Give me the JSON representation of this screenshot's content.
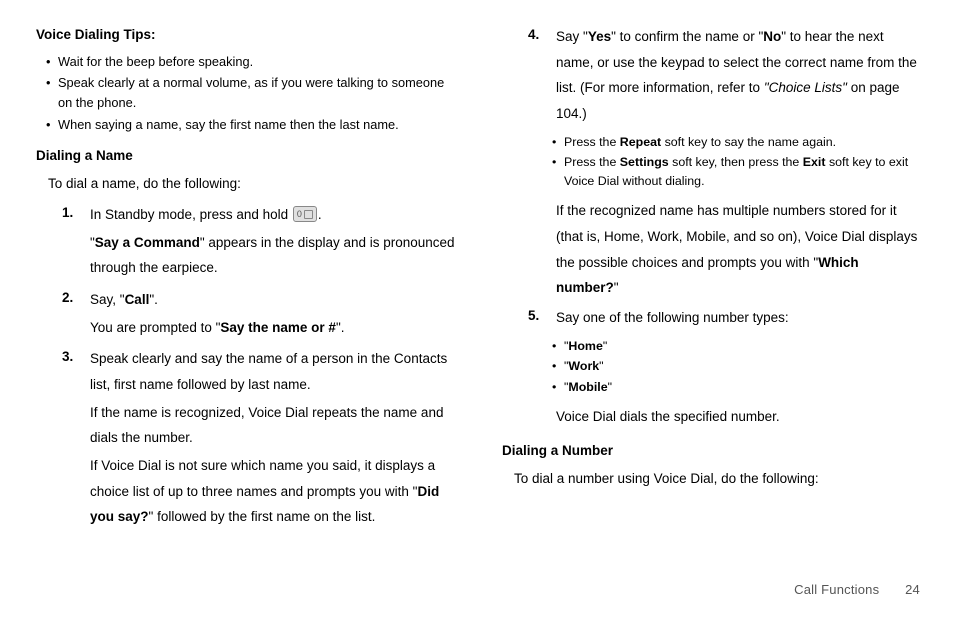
{
  "left": {
    "tipsHeader": "Voice Dialing Tips:",
    "tips": {
      "t1": "Wait for the beep before speaking.",
      "t2": "Speak clearly at a normal volume, as if you were talking to someone on the phone.",
      "t3": "When saying a name, say the first name then the last name."
    },
    "nameHeader": "Dialing a Name",
    "nameIntro": "To dial a name, do the following:",
    "s1": {
      "num": "1.",
      "a": "In Standby mode, press and hold ",
      "b": ".",
      "c1": "\"",
      "c2": "Say a Command",
      "c3": "\" appears in the display and is pronounced through the earpiece."
    },
    "s2": {
      "num": "2.",
      "a1": "Say, \"",
      "a2": "Call",
      "a3": "\".",
      "b1": "You are prompted to \"",
      "b2": "Say the name or #",
      "b3": "\"."
    },
    "s3": {
      "num": "3.",
      "a": "Speak clearly and say the name of a person in the Contacts list, first name followed by last name.",
      "b": "If the name is recognized, Voice Dial repeats the name and dials the number.",
      "c1": "If Voice Dial is not sure which name you said, it displays a choice list of up to three names and prompts you with \"",
      "c2": "Did you say?",
      "c3": "\" followed by the first name on the list."
    }
  },
  "right": {
    "s4": {
      "num": "4.",
      "a1": "Say \"",
      "a2": "Yes",
      "a3": "\" to confirm the name or \"",
      "a4": "No",
      "a5": "\" to hear the next name, or use the keypad to select the correct name from the list. (For more information, refer to ",
      "a6": "\"Choice Lists\"",
      "a7": "  on page 104.)",
      "b1a": "Press the ",
      "b1b": "Repeat",
      "b1c": " soft key to say the name again.",
      "b2a": "Press the ",
      "b2b": "Settings",
      "b2c": " soft key, then press the ",
      "b2d": "Exit",
      "b2e": " soft key to exit Voice Dial without dialing.",
      "c1": "If the recognized name has multiple numbers stored for it (that is, Home, Work, Mobile, and so on), Voice Dial displays the possible choices and prompts you with \"",
      "c2": "Which number?",
      "c3": "\""
    },
    "s5": {
      "num": "5.",
      "a": "Say one of the following number types:",
      "home1": "\"",
      "home2": "Home",
      "home3": "\"",
      "work1": "\"",
      "work2": "Work",
      "work3": "\"",
      "mobile1": "\"",
      "mobile2": "Mobile",
      "mobile3": "\"",
      "after": "Voice Dial dials the specified number."
    },
    "numberHeader": "Dialing a Number",
    "numberIntro": "To dial a number using Voice Dial, do the following:"
  },
  "footer": {
    "section": "Call Functions",
    "page": "24"
  }
}
